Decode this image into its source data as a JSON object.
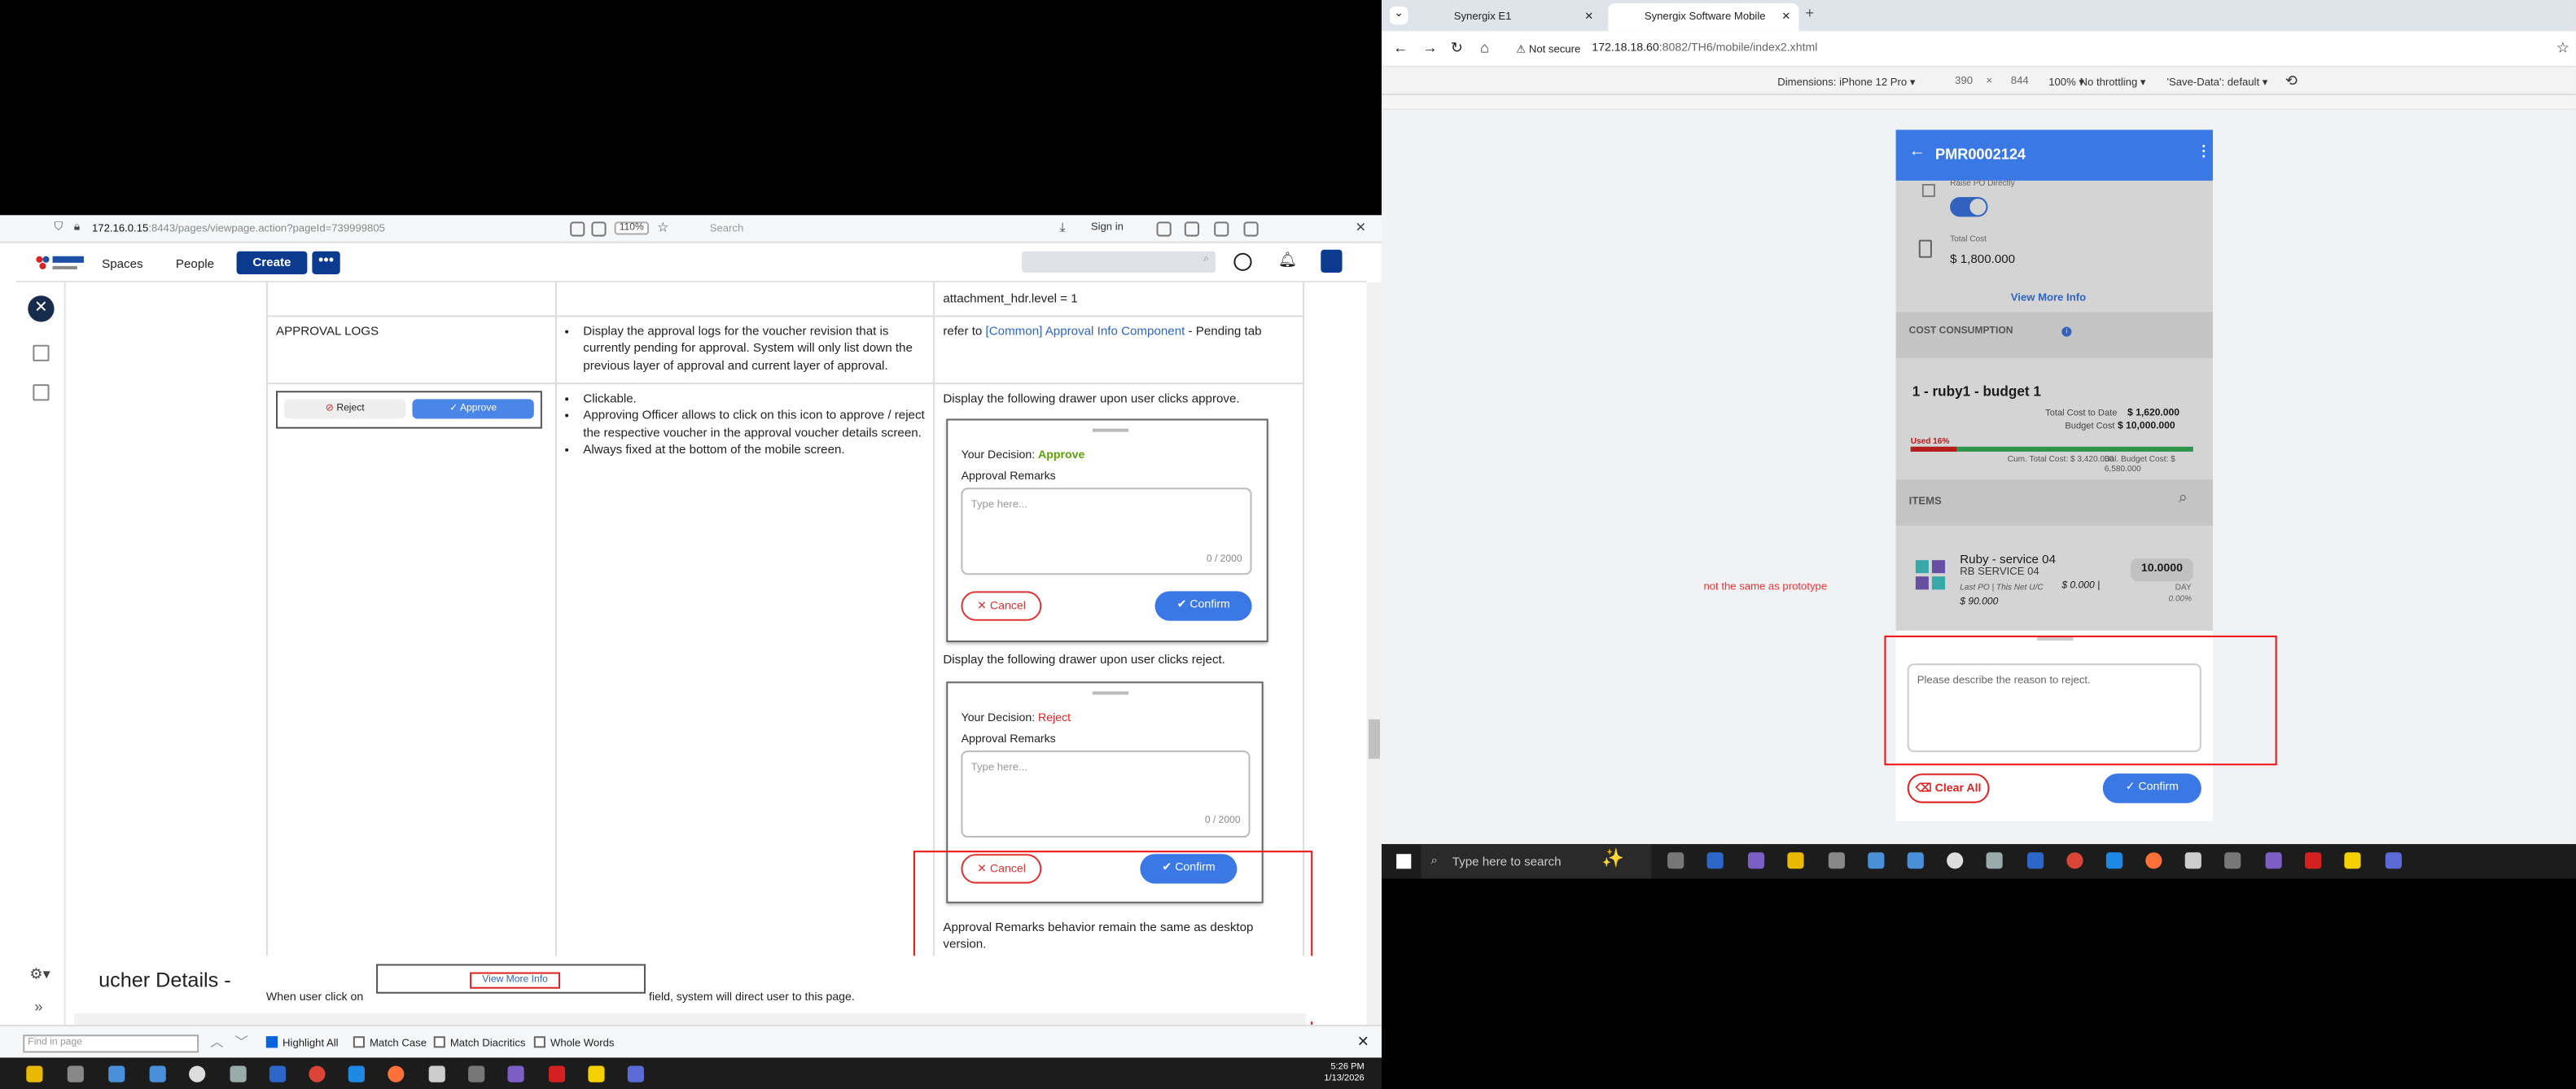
{
  "left_browser": {
    "url_host": "172.16.0.15",
    "url_path": ":8443/pages/viewpage.action?pageId=739999805",
    "zoom": "110%",
    "search_placeholder": "Search",
    "sign_in": "Sign in",
    "nav": {
      "spaces": "Spaces",
      "people": "People",
      "create": "Create",
      "more": "•••"
    },
    "rows": [
      {
        "top_text": "attachment_hdr.level = 1"
      },
      {
        "name": "APPROVAL LOGS",
        "desc": "Display the approval logs for the voucher revision that is currently pending for approval. System will only list down the previous layer of approval and current layer of approval.",
        "ref_prefix": "refer to ",
        "ref_link": "[Common] Approval Info Component",
        "ref_suffix": " - Pending tab"
      },
      {
        "mini_reject": "Reject",
        "mini_approve": "Approve",
        "bullets": [
          "Clickable.",
          "Approving Officer allows to click on this icon to approve / reject the respective voucher in the approval voucher details screen.",
          "Always fixed at the bottom of the mobile screen."
        ],
        "approve_intro": "Display the following drawer upon user clicks approve.",
        "reject_intro": "Display the following drawer upon user clicks reject.",
        "remarks_note": "Approval Remarks behavior remain the same as desktop version."
      }
    ],
    "drawer": {
      "decision_label": "Your Decision: ",
      "approve_word": "Approve",
      "reject_word": "Reject",
      "remarks_label": "Approval Remarks",
      "placeholder": "Type here...",
      "counter": "0 / 2000",
      "cancel": "Cancel",
      "confirm": "Confirm"
    },
    "voucher": {
      "heading": "ucher Details -",
      "text_before": "When user click on",
      "button": "View More Info",
      "text_after": "field, system will direct user to this page."
    },
    "find": {
      "placeholder": "Find in page",
      "highlight": "Highlight All",
      "match_case": "Match Case",
      "diacritics": "Match Diacritics",
      "whole": "Whole Words"
    },
    "clock": {
      "time": "5:26 PM",
      "date": "1/13/2026"
    }
  },
  "right_browser": {
    "tabs": [
      "Synergix E1",
      "Synergix Software Mobile"
    ],
    "not_secure": "Not secure",
    "url_host": "172.18.18.60",
    "url_path": ":8082/TH6/mobile/index2.xhtml",
    "device": {
      "dimensions": "Dimensions: iPhone 12 Pro",
      "w": "390",
      "x": "×",
      "h": "844",
      "zoom": "100%",
      "throttle": "No throttling",
      "save_data": "'Save-Data': default"
    },
    "note": "not the same as prototype",
    "taskbar_search": "Type here to search"
  },
  "phone": {
    "title": "PMR0002124",
    "raise_po": "Raise PO Directly",
    "total_cost_label": "Total Cost",
    "total_cost": "$ 1,800.000",
    "view_more": "View More Info",
    "cost_consumption": "COST CONSUMPTION",
    "budget_name": "1 - ruby1 - budget 1",
    "total_to_date_label": "Total Cost to Date",
    "total_to_date": "$ 1,620.000",
    "budget_label": "Budget Cost",
    "budget": "$ 10,000.000",
    "used": "Used 16%",
    "used_pct": 16,
    "cum_total": "Cum. Total Cost: $ 3,420.000",
    "bal_budget": "Bal. Budget Cost: $ 6,580.000",
    "items": "ITEMS",
    "item_name": "Ruby - service 04",
    "item_code": "RB SERVICE 04",
    "item_meta": "Last PO | This Net U/C",
    "item_price": "$ 0.000 |",
    "item_total": "$ 90.000",
    "qty": "10.0000",
    "uom": "DAY",
    "pct": "0.00%",
    "reject_placeholder": "Please describe the reason to reject.",
    "clear_all": "Clear All",
    "confirm": "Confirm"
  },
  "colors": {
    "accent": "#3a78e6",
    "danger": "#e11",
    "confluence_nav": "#0b3a8f",
    "approve_green": "#5aa300"
  }
}
